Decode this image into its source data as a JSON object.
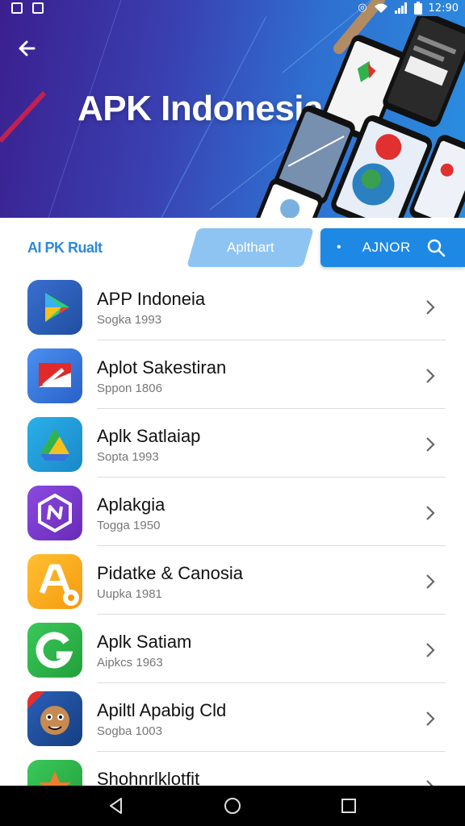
{
  "status_bar": {
    "time": "12:90"
  },
  "hero": {
    "title": "APK Indonesia",
    "back_icon": "arrow-back-icon"
  },
  "filter_row": {
    "brand_label": "AI PK Rualt",
    "chip_label": "Aplthart",
    "search_label": "AJNOR",
    "search_icon": "search-icon"
  },
  "apps": [
    {
      "name": "APP Indoneia",
      "sub": "Sogka 1993",
      "icon_name": "play-store-icon",
      "color": "#2b5fb5"
    },
    {
      "name": "Aplot Sakestiran",
      "sub": "Sppon 1806",
      "icon_name": "red-flag-app-icon",
      "color": "#3b7fe0"
    },
    {
      "name": "Aplk Satlaiap",
      "sub": "Sopta 1993",
      "icon_name": "drive-app-icon",
      "color": "#1aa4d8"
    },
    {
      "name": "Aplakgia",
      "sub": "Togga 1950",
      "icon_name": "hexagon-n-app-icon",
      "color": "#7b3fd0"
    },
    {
      "name": "Pidatke & Canosia",
      "sub": "Uupka 1981",
      "icon_name": "letter-a-app-icon",
      "color": "#f5a623"
    },
    {
      "name": "Aplk Satiam",
      "sub": "Aipkcs 1963",
      "icon_name": "letter-g-app-icon",
      "color": "#2fb34a"
    },
    {
      "name": "Apiltl Apabig Cld",
      "sub": "Sogba 1003",
      "icon_name": "cartoon-character-app-icon",
      "color": "#1e4fa0"
    },
    {
      "name": "Shohnrlklotfit",
      "sub": "",
      "icon_name": "star-burst-app-icon",
      "color": "#2fb34a"
    }
  ],
  "nav_bar": {
    "back": "nav-back-icon",
    "home": "nav-home-icon",
    "recents": "nav-recents-icon"
  }
}
